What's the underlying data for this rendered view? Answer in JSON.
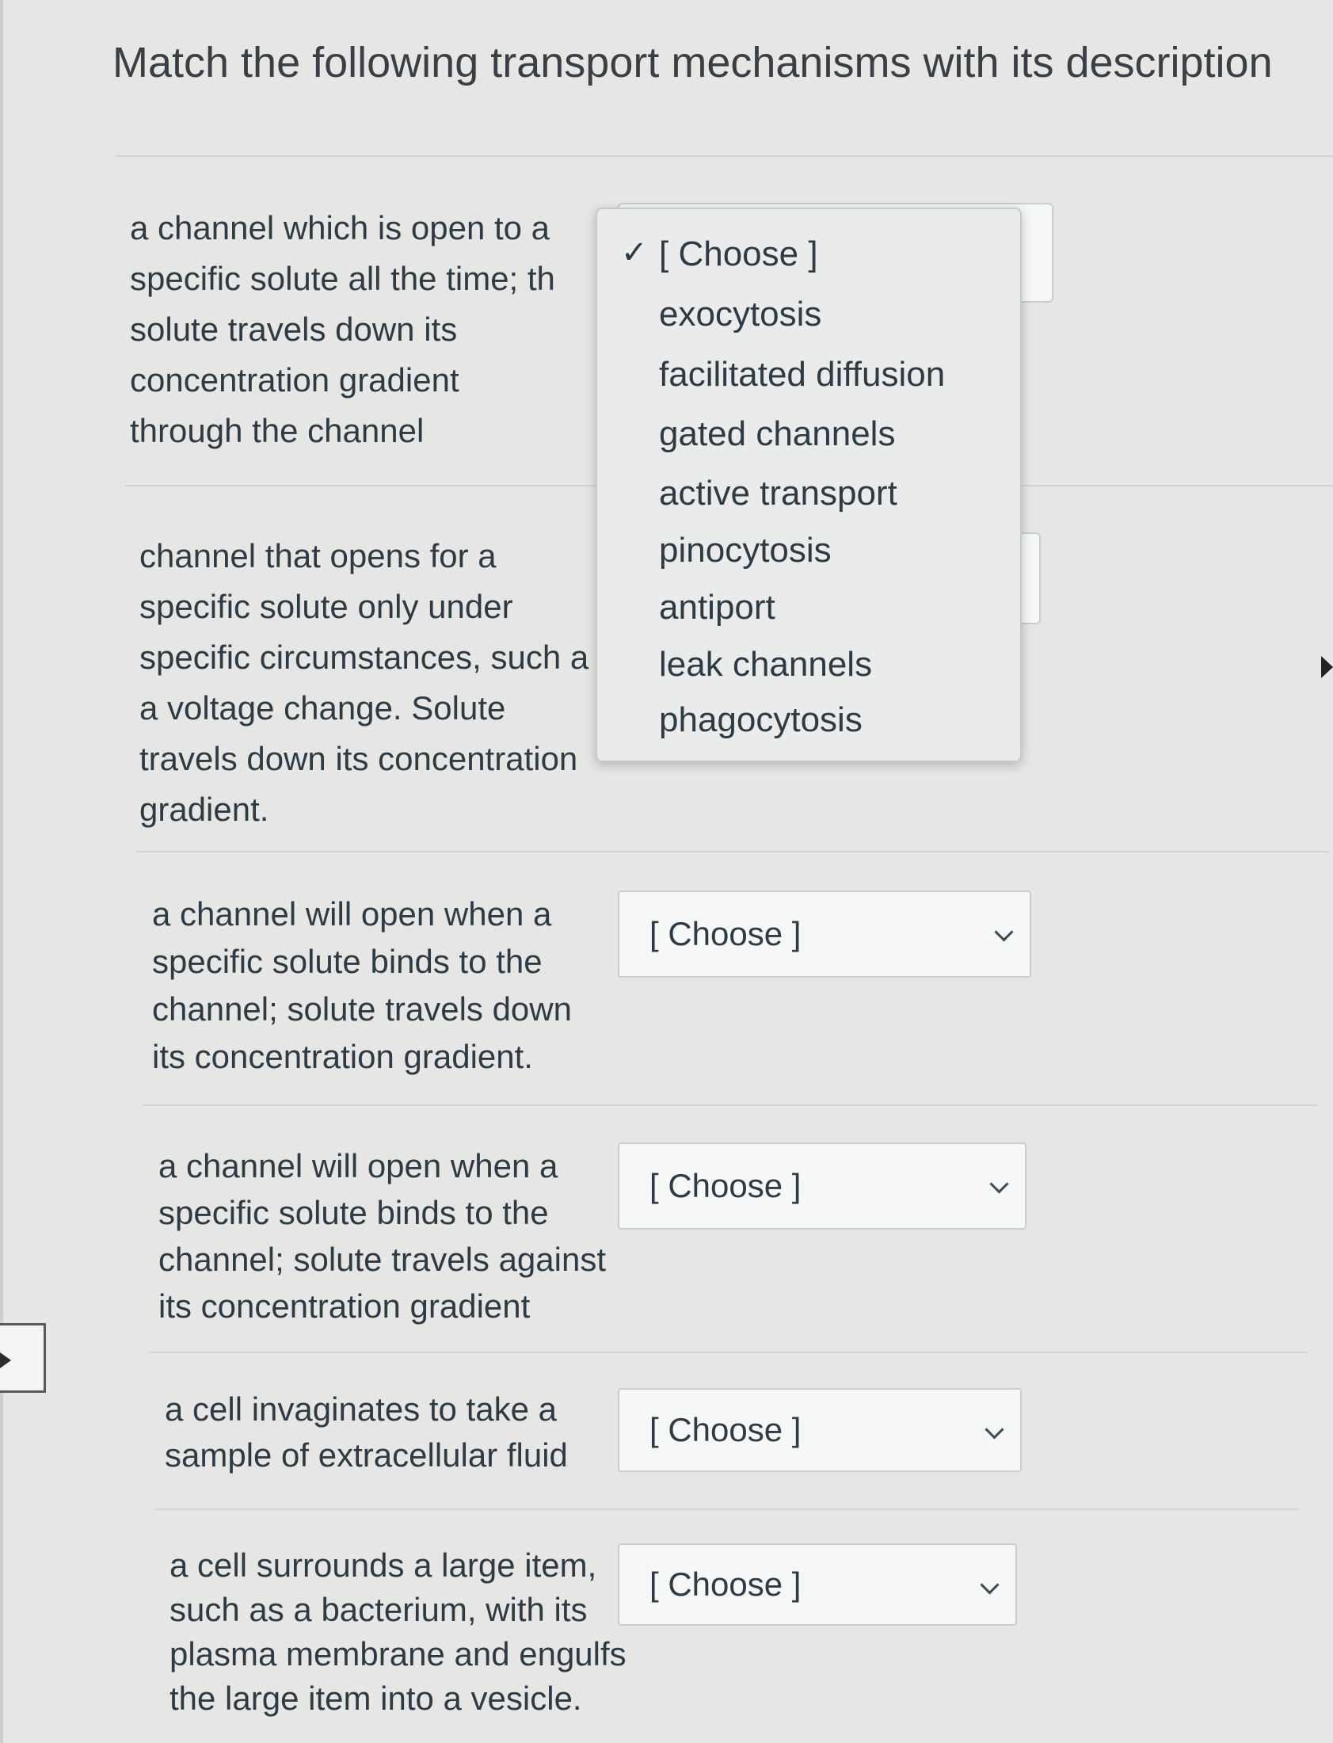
{
  "title": "Match the following transport mechanisms with its description",
  "dropdown_open": {
    "selected": "[ Choose ]",
    "options": [
      "[ Choose ]",
      "exocytosis",
      "facilitated diffusion",
      "gated channels",
      "active transport",
      "pinocytosis",
      "antiport",
      "leak channels",
      "phagocytosis"
    ]
  },
  "items": [
    {
      "prompt_lines": [
        "a channel which is open to a",
        "specific solute all the time; th",
        "solute travels down its",
        "concentration gradient",
        "through the channel"
      ],
      "value": "[ Choose ]"
    },
    {
      "prompt_lines": [
        "channel that opens for a",
        "specific solute only under",
        "specific circumstances, such a",
        "a voltage change. Solute",
        "travels down its concentration",
        "gradient."
      ],
      "value": "[ Choose ]"
    },
    {
      "prompt_lines": [
        "a channel will open when a",
        "specific solute binds to the",
        "channel; solute travels down",
        "its concentration gradient."
      ],
      "value": "[ Choose ]"
    },
    {
      "prompt_lines": [
        "a channel will open when a",
        "specific solute binds to the",
        "channel; solute travels against",
        "its concentration gradient"
      ],
      "value": "[ Choose ]"
    },
    {
      "prompt_lines": [
        "a cell invaginates to take a",
        "sample of extracellular fluid"
      ],
      "value": "[ Choose ]"
    },
    {
      "prompt_lines": [
        "a cell surrounds a large item,",
        "such as a bacterium, with its",
        "plasma membrane and engulfs",
        "the large item into a vesicle."
      ],
      "value": "[ Choose ]"
    }
  ]
}
